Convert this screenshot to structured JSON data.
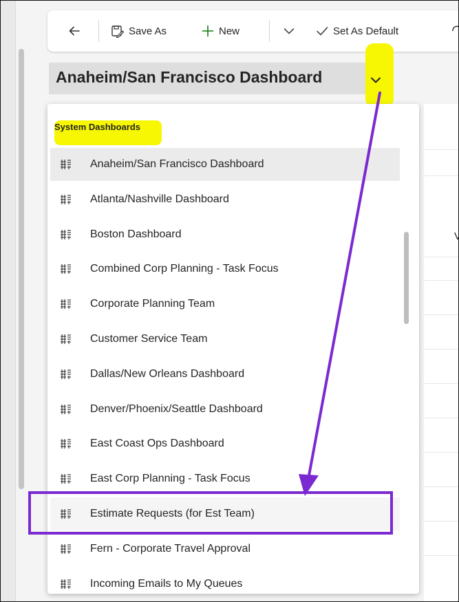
{
  "toolbar": {
    "back_label": "",
    "save_as_label": "Save As",
    "new_label": "New",
    "set_default_label": "Set As Default"
  },
  "dashboard": {
    "title": "Anaheim/San Francisco Dashboard"
  },
  "dropdown": {
    "header": "System Dashboards",
    "items": [
      {
        "label": "Anaheim/San Francisco Dashboard"
      },
      {
        "label": "Atlanta/Nashville Dashboard"
      },
      {
        "label": "Boston Dashboard"
      },
      {
        "label": "Combined Corp Planning - Task Focus"
      },
      {
        "label": "Corporate Planning Team"
      },
      {
        "label": "Customer Service Team"
      },
      {
        "label": "Dallas/New Orleans Dashboard"
      },
      {
        "label": "Denver/Phoenix/Seattle Dashboard"
      },
      {
        "label": "East Coast Ops Dashboard"
      },
      {
        "label": "East Corp Planning - Task Focus"
      },
      {
        "label": "Estimate Requests (for Est Team)"
      },
      {
        "label": "Fern - Corporate Travel Approval"
      },
      {
        "label": "Incoming Emails to My Queues"
      }
    ],
    "selected_index": 0,
    "highlighted_index": 10
  },
  "background_page": {
    "column_letter": "V"
  },
  "colors": {
    "annotation_highlight": "#f7f704",
    "annotation_purple": "#7a2ad0",
    "new_icon": "#107c10"
  }
}
